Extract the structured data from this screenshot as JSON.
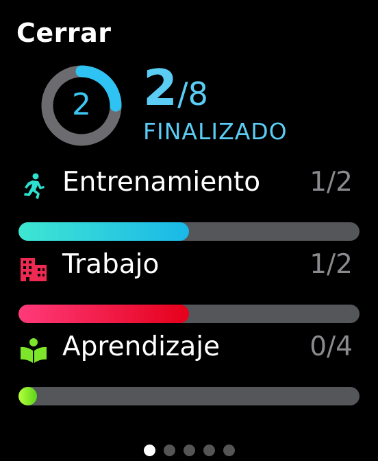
{
  "header": {
    "close_label": "Cerrar"
  },
  "summary": {
    "completed": "2",
    "slash_total": "/8",
    "status_label": "FINALIZADO",
    "ring_value": "2",
    "ring_progress": 0.25,
    "accent_color": "#5bcdf5"
  },
  "goals": [
    {
      "name": "Entrenamiento",
      "count": "1/2",
      "progress": 0.5,
      "icon": "running-figure-icon",
      "colors": [
        "#3ee6d2",
        "#1ab8e8"
      ]
    },
    {
      "name": "Trabajo",
      "count": "1/2",
      "progress": 0.5,
      "icon": "office-building-icon",
      "colors": [
        "#ff3a7a",
        "#e5001a"
      ]
    },
    {
      "name": "Aprendizaje",
      "count": "0/4",
      "progress": 0.0,
      "icon": "open-book-reader-icon",
      "colors": [
        "#b7ff3a",
        "#5bd61a"
      ]
    }
  ],
  "pagination": {
    "pages": 5,
    "current": 1
  }
}
